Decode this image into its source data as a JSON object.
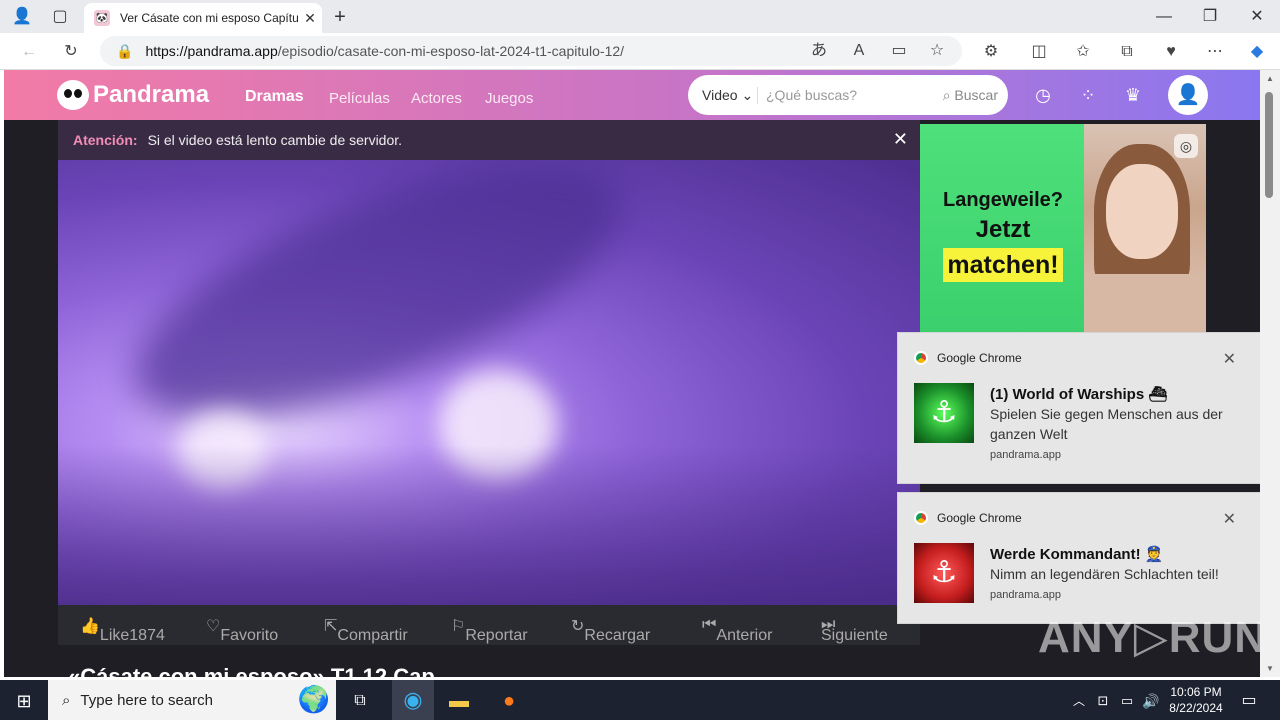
{
  "browser": {
    "tab_title": "Ver Cásate con mi esposo Capítul",
    "tab_favicon": "panda-icon",
    "url_host": "https://pandrama.app",
    "url_path": "/episodio/casate-con-mi-esposo-lat-2024-t1-capitulo-12/"
  },
  "site": {
    "logo_text": "Pandrama",
    "nav": [
      "Dramas",
      "Películas",
      "Actores",
      "Juegos"
    ],
    "search": {
      "type_label": "Video",
      "placeholder": "¿Qué buscas?",
      "button_label": "Buscar"
    },
    "colors": {
      "header_start": "#f27ba6",
      "header_end": "#8a77f0",
      "accent": "#f28db6"
    }
  },
  "player": {
    "notice_label": "Atención:",
    "notice_text": "Si el video está lento cambie de servidor.",
    "controls": [
      "Like1874",
      "Favorito",
      "Compartir",
      "Reportar",
      "Recargar",
      "Anterior",
      "Siguiente"
    ]
  },
  "below_title": "«Cásate con mi esposo» T1 12 Cap",
  "ad": {
    "line1": "Langeweile?",
    "line2": "Jetzt",
    "line3": "matchen!"
  },
  "notifications": [
    {
      "app": "Google Chrome",
      "title": "(1) World of Warships ⛴",
      "body": "Spielen Sie gegen Menschen aus der ganzen Welt",
      "source": "pandrama.app",
      "color": "#1b8f2a"
    },
    {
      "app": "Google Chrome",
      "title": "Werde Kommandant! 👮",
      "body": "Nimm an legendären Schlachten teil!",
      "source": "pandrama.app",
      "color": "#c41d1d"
    }
  ],
  "watermark": "ANY▷RUN",
  "taskbar": {
    "search_placeholder": "Type here to search",
    "time": "10:06 PM",
    "date": "8/22/2024"
  }
}
